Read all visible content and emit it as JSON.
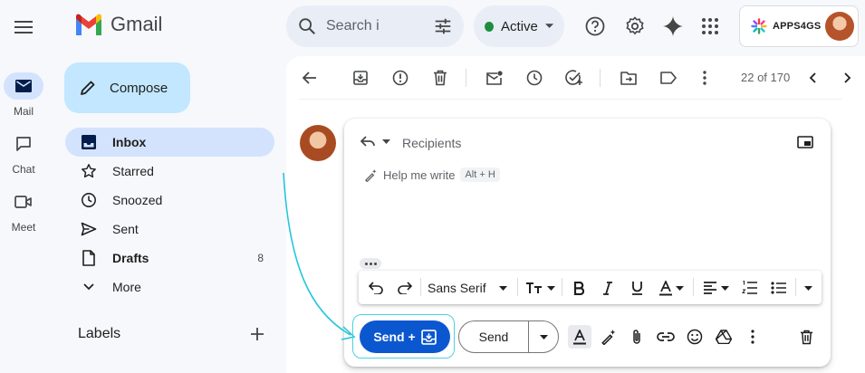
{
  "app": {
    "name": "Gmail"
  },
  "colors": {
    "accent": "#0b57d0",
    "active_green": "#1e8e3e",
    "compose_bg": "#c2e7ff",
    "selected_nav": "#d3e3fd",
    "highlight": "#4dd0e1"
  },
  "search": {
    "placeholder": "Search i"
  },
  "status": {
    "label": "Active"
  },
  "account": {
    "brand": "APPS4GS"
  },
  "rail": [
    {
      "label": "Mail",
      "icon": "mail-icon",
      "active": true
    },
    {
      "label": "Chat",
      "icon": "chat-icon",
      "active": false
    },
    {
      "label": "Meet",
      "icon": "video-icon",
      "active": false
    }
  ],
  "compose": {
    "label": "Compose"
  },
  "nav": [
    {
      "label": "Inbox",
      "icon": "inbox-icon",
      "selected": true,
      "count": ""
    },
    {
      "label": "Starred",
      "icon": "star-icon",
      "selected": false,
      "count": ""
    },
    {
      "label": "Snoozed",
      "icon": "clock-icon",
      "selected": false,
      "count": ""
    },
    {
      "label": "Sent",
      "icon": "send-icon",
      "selected": false,
      "count": ""
    },
    {
      "label": "Drafts",
      "icon": "draft-icon",
      "selected": false,
      "count": "8"
    },
    {
      "label": "More",
      "icon": "chevron-down-icon",
      "selected": false,
      "count": ""
    }
  ],
  "labels": {
    "title": "Labels"
  },
  "toolbar": {
    "counter": "22 of 170"
  },
  "reply": {
    "recipients_placeholder": "Recipients",
    "help_label": "Help me write",
    "help_shortcut": "Alt + H"
  },
  "format": {
    "font": "Sans Serif"
  },
  "actions": {
    "send_plus_label": "Send +",
    "send_label": "Send"
  }
}
